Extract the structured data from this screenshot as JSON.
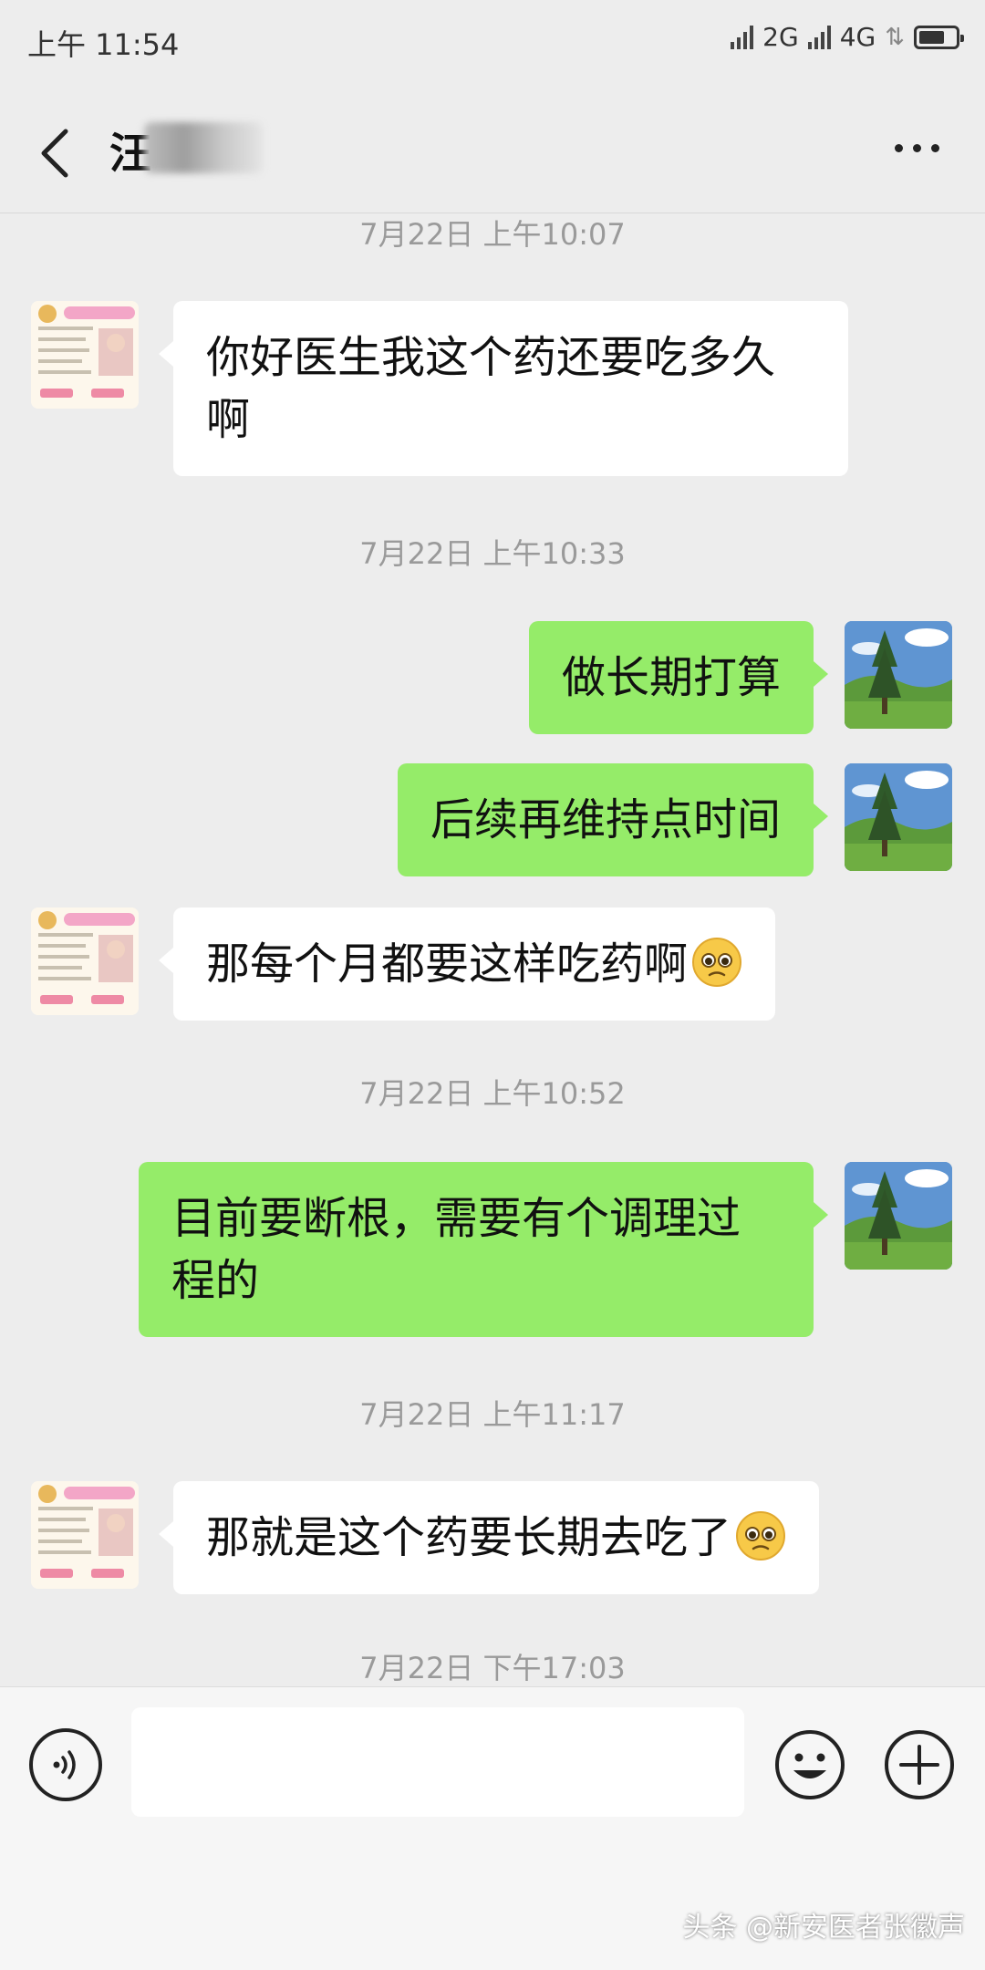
{
  "status_bar": {
    "time": "上午 11:54",
    "network_1": "2G",
    "network_2": "4G"
  },
  "header": {
    "contact_name": "汪"
  },
  "messages": [
    {
      "type": "timestamp",
      "text": "7月22日 上午10:07"
    },
    {
      "type": "incoming",
      "text": "你好医生我这个药还要吃多久啊"
    },
    {
      "type": "timestamp",
      "text": "7月22日 上午10:33"
    },
    {
      "type": "outgoing",
      "text": "做长期打算"
    },
    {
      "type": "outgoing",
      "text": "后续再维持点时间"
    },
    {
      "type": "incoming",
      "text": "那每个月都要这样吃药啊",
      "emoji": "pleading-face-emoji"
    },
    {
      "type": "timestamp",
      "text": "7月22日 上午10:52"
    },
    {
      "type": "outgoing",
      "text": "目前要断根，需要有个调理过程的"
    },
    {
      "type": "timestamp",
      "text": "7月22日 上午11:17"
    },
    {
      "type": "incoming",
      "text": "那就是这个药要长期去吃了",
      "emoji": "pleading-face-emoji"
    },
    {
      "type": "timestamp",
      "text": "7月22日 下午17:03"
    }
  ],
  "input_bar": {
    "value": "",
    "placeholder": ""
  },
  "watermark": "头条 @新安医者张徽声",
  "icons": {
    "back": "back-arrow-icon",
    "more": "more-dots-icon",
    "voice": "voice-icon",
    "emoji": "emoji-face-icon",
    "plus": "plus-icon"
  },
  "colors": {
    "background": "#ededed",
    "outgoing_bubble": "#95ec69",
    "incoming_bubble": "#ffffff",
    "timestamp": "#9a9a9a"
  }
}
